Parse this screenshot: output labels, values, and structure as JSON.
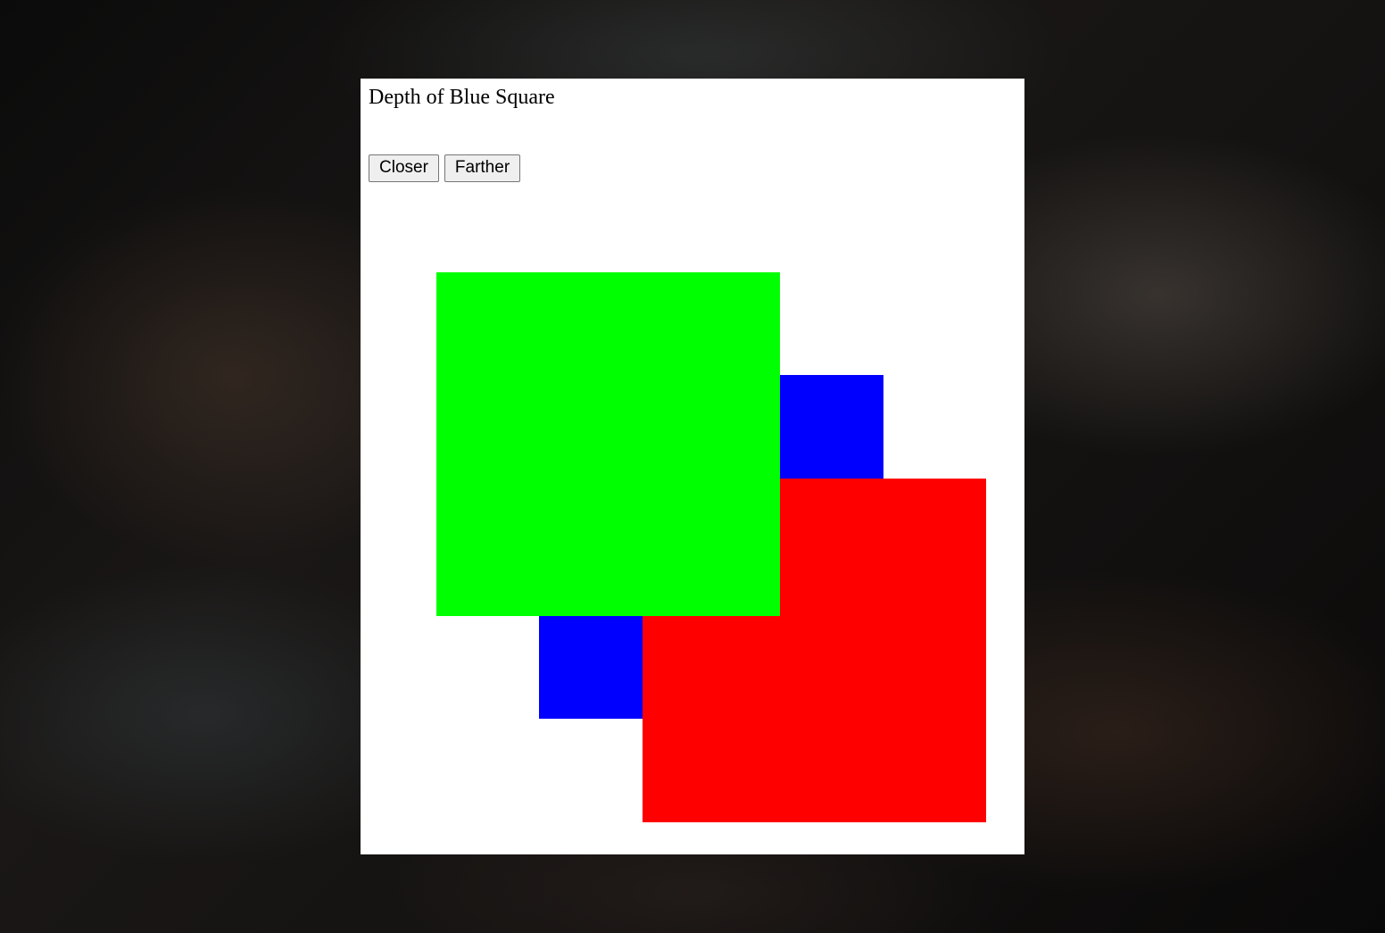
{
  "page": {
    "title": "Depth of Blue Square"
  },
  "controls": {
    "closer_label": "Closer",
    "farther_label": "Farther"
  },
  "squares": [
    {
      "name": "blue-square",
      "color": "#0000ff",
      "depth_order": 1
    },
    {
      "name": "red-square",
      "color": "#ff0000",
      "depth_order": 2
    },
    {
      "name": "green-square",
      "color": "#00ff00",
      "depth_order": 3
    }
  ]
}
